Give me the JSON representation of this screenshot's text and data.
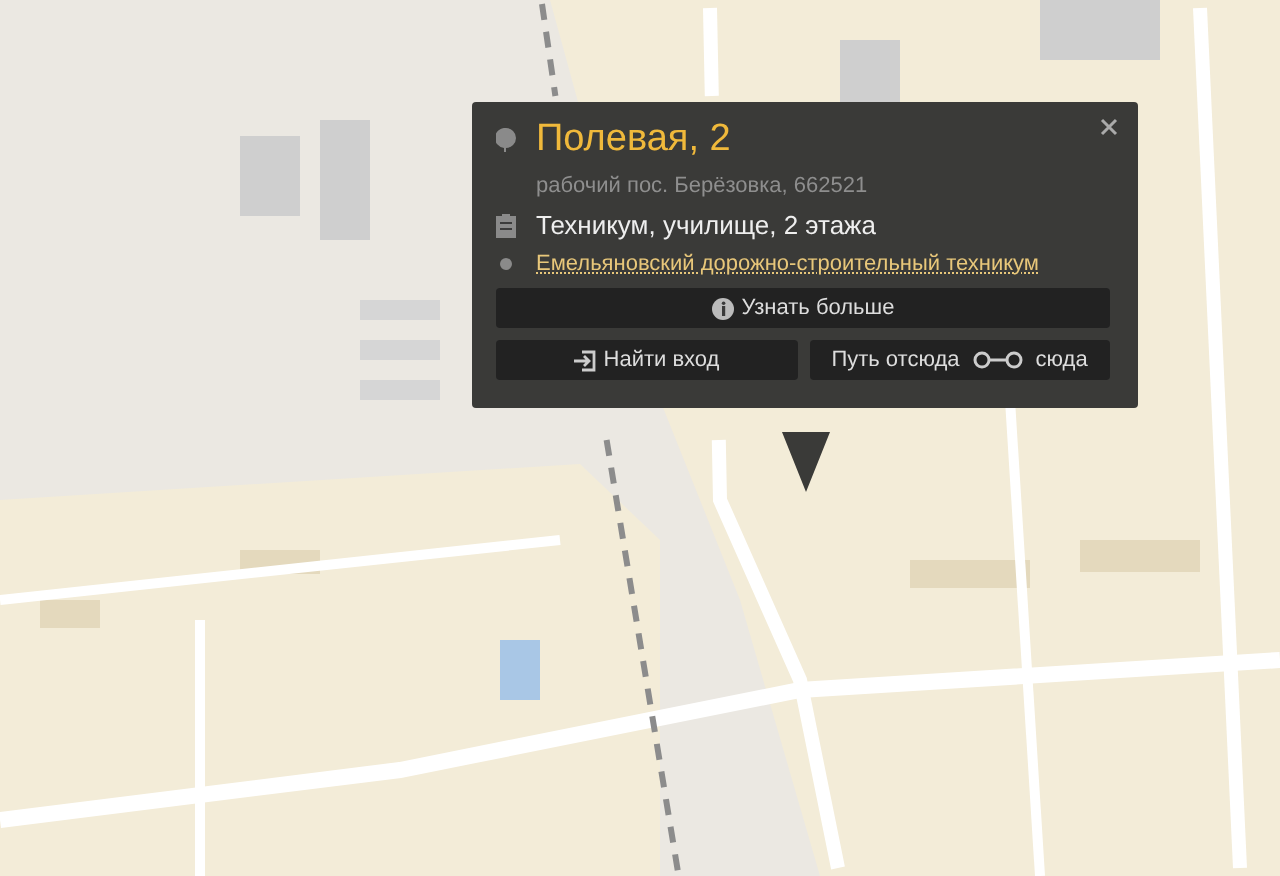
{
  "popup": {
    "title": "Полевая, 2",
    "address": "рабочий пос. Берёзовка, 662521",
    "building": "Техникум, училище, 2 этажа",
    "organization": "Емельяновский дорожно-строительный техникум",
    "more_button": "Узнать больше",
    "entrance_button": "Найти вход",
    "route_from": "Путь отсюда",
    "route_to": "сюда"
  }
}
